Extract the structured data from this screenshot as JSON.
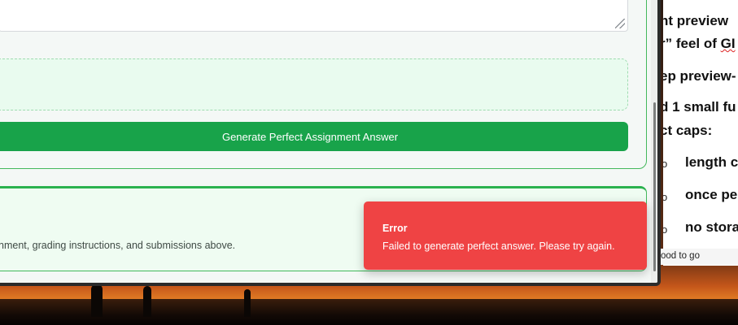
{
  "app": {
    "generate_button_label": "Generate Perfect Assignment Answer",
    "result_hint_text": "nment, grading instructions, and submissions above."
  },
  "toast": {
    "title": "Error",
    "message": "Failed to generate perfect answer. Please try again.",
    "color": "#ef4344"
  },
  "document": {
    "lines": [
      "nt preview",
      "r” feel of ",
      "ep preview-",
      "d 1 small fu",
      "ct caps:"
    ],
    "underlined_fragment": "GI",
    "bullets": [
      {
        "marker": "o",
        "text": "length c"
      },
      {
        "marker": "o",
        "text": "once pe"
      },
      {
        "marker": "o",
        "text": "no stora"
      }
    ],
    "status_text": "ood to go"
  },
  "colors": {
    "accent_green": "#18a34a",
    "card_border": "#43b85c",
    "error_red": "#ef4344"
  }
}
